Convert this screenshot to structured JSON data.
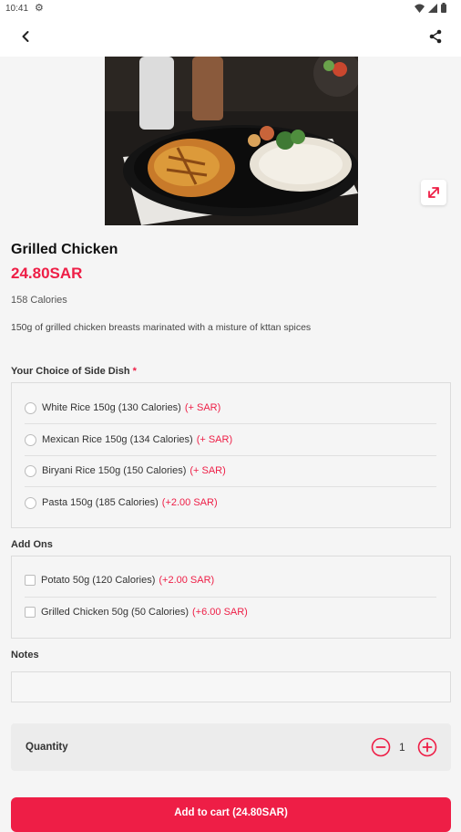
{
  "status_bar": {
    "time": "10:41"
  },
  "dish": {
    "name": "Grilled Chicken",
    "price": "24.80SAR",
    "calories": "158 Calories",
    "description": "150g of grilled chicken breasts marinated with a misture of kttan spices"
  },
  "side_dish": {
    "title": "Your Choice of Side Dish",
    "required_mark": "*",
    "options": [
      {
        "label": "White Rice 150g (130 Calories)",
        "extra": "(+ SAR)"
      },
      {
        "label": "Mexican Rice 150g (134 Calories)",
        "extra": "(+ SAR)"
      },
      {
        "label": "Biryani Rice 150g (150 Calories)",
        "extra": "(+ SAR)"
      },
      {
        "label": "Pasta 150g (185 Calories)",
        "extra": "(+2.00 SAR)"
      }
    ]
  },
  "add_ons": {
    "title": "Add Ons",
    "options": [
      {
        "label": "Potato 50g (120 Calories)",
        "extra": "(+2.00 SAR)"
      },
      {
        "label": "Grilled Chicken 50g (50 Calories)",
        "extra": "(+6.00 SAR)"
      }
    ]
  },
  "notes": {
    "title": "Notes",
    "value": "",
    "placeholder": ""
  },
  "quantity": {
    "label": "Quantity",
    "value": "1"
  },
  "cart_button": {
    "label": "Add to cart (24.80SAR)"
  },
  "colors": {
    "accent": "#ee1e46",
    "background": "#f5f5f5"
  },
  "icons": [
    "settings-icon",
    "wifi-icon",
    "signal-icon",
    "battery-icon",
    "back-icon",
    "share-icon",
    "expand-icon",
    "minus-icon",
    "plus-icon"
  ]
}
